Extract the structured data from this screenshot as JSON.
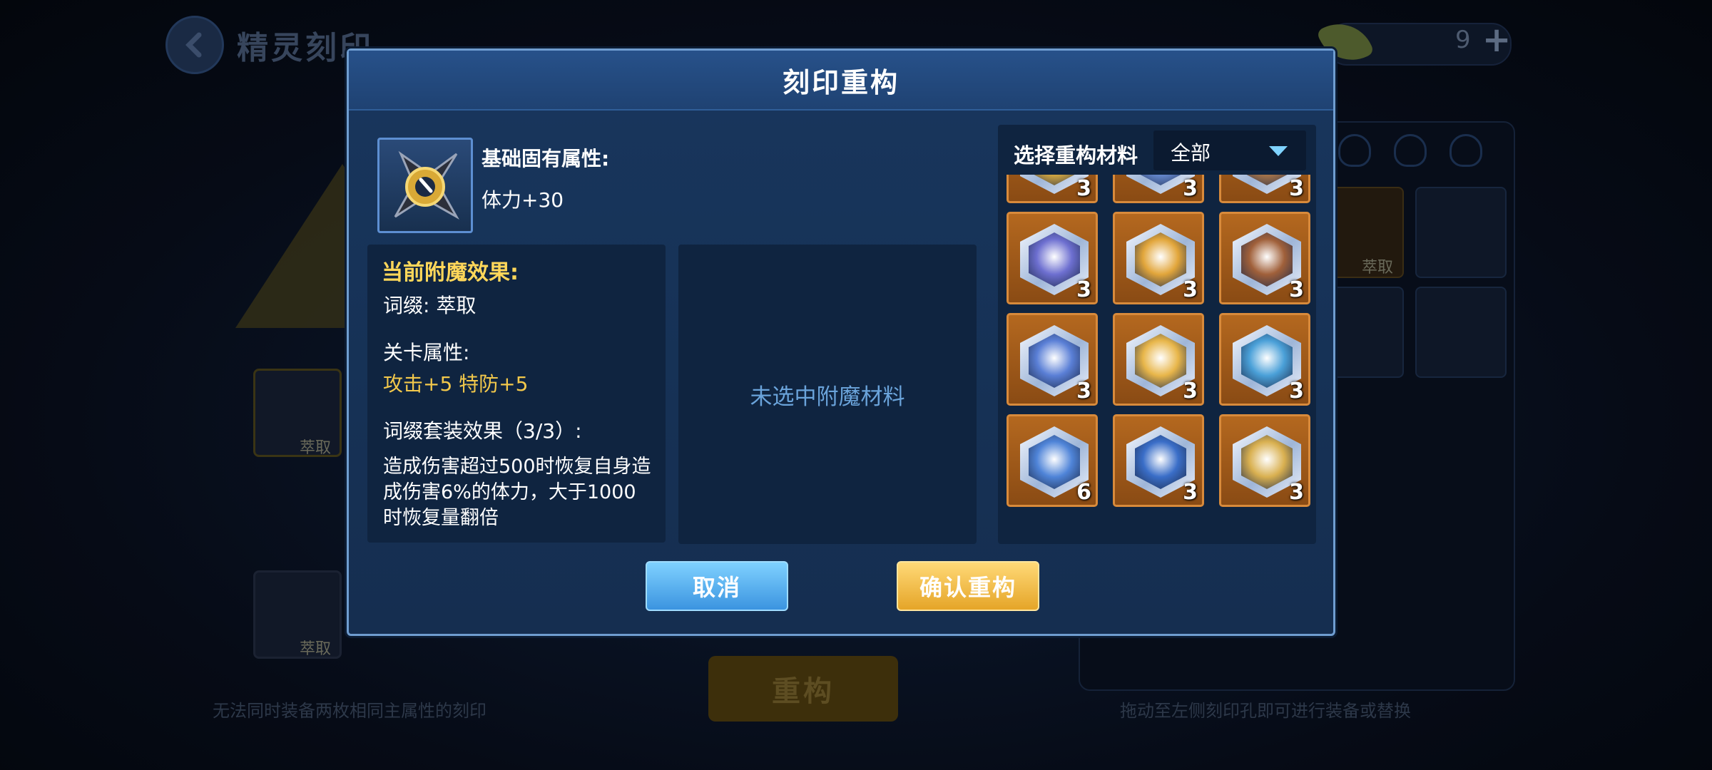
{
  "background": {
    "title": "精灵刻印",
    "currency_count": "9",
    "slot_label_1": "萃取",
    "slot_label_2": "萃取",
    "right_panel_label": "萃取",
    "rebuild_button": "重构",
    "hint_left": "无法同时装备两枚相同主属性的刻印",
    "hint_right": "拖动至左侧刻印孔即可进行装备或替换"
  },
  "dialog": {
    "title": "刻印重构",
    "base_attr_title": "基础固有属性:",
    "base_attr_value": "体力+30",
    "effect": {
      "title": "当前附魔效果:",
      "affix": "词缀: 萃取",
      "stage_title": "关卡属性:",
      "stage_values": "攻击+5  特防+5",
      "set_title": "词缀套装效果（3/3）:",
      "set_desc": "造成伤害超过500时恢复自身造成伤害6%的体力，大于1000时恢复量翻倍"
    },
    "empty_text": "未选中附魔材料",
    "materials": {
      "title": "选择重构材料",
      "filter": "全部",
      "items": [
        {
          "count": "3",
          "color": "#e0b040"
        },
        {
          "count": "3",
          "color": "#6a8fd8"
        },
        {
          "count": "3",
          "color": "#b07a4a"
        },
        {
          "count": "3",
          "color": "#6d6fd0"
        },
        {
          "count": "3",
          "color": "#e2a63b"
        },
        {
          "count": "3",
          "color": "#a0603a"
        },
        {
          "count": "3",
          "color": "#5a7fd6"
        },
        {
          "count": "3",
          "color": "#e8b64a"
        },
        {
          "count": "3",
          "color": "#4aa0d8"
        },
        {
          "count": "6",
          "color": "#4f84d8"
        },
        {
          "count": "3",
          "color": "#3a6ec8"
        },
        {
          "count": "3",
          "color": "#d9b050"
        }
      ]
    },
    "cancel_label": "取消",
    "confirm_label": "确认重构"
  }
}
